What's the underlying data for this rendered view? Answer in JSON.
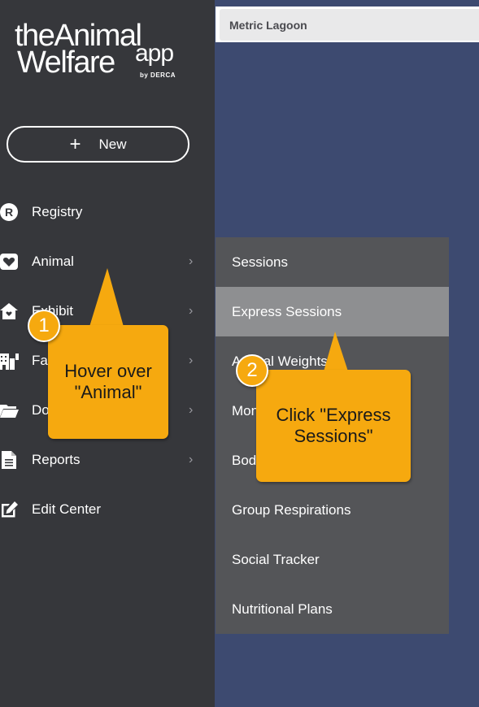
{
  "logo": {
    "line1": "theAnimal",
    "line2": "Welfare",
    "line3": "app",
    "byline": "by DERCA"
  },
  "new_button": {
    "label": "New"
  },
  "topbar": {
    "field_text": "Metric Lagoon"
  },
  "nav": [
    {
      "label": "Registry",
      "icon": "registry-r-icon",
      "chevron": false
    },
    {
      "label": "Animal",
      "icon": "heart-icon",
      "chevron": true
    },
    {
      "label": "Exhibit",
      "icon": "exhibit-home-icon",
      "chevron": true
    },
    {
      "label": "Facilities",
      "icon": "building-icon",
      "chevron": true
    },
    {
      "label": "Documents",
      "icon": "folder-icon",
      "chevron": true
    },
    {
      "label": "Reports",
      "icon": "report-document-icon",
      "chevron": true
    },
    {
      "label": "Edit Center",
      "icon": "edit-icon",
      "chevron": false
    }
  ],
  "submenu": [
    {
      "label": "Sessions",
      "active": false
    },
    {
      "label": "Express Sessions",
      "active": true
    },
    {
      "label": "Animal Weights",
      "active": false
    },
    {
      "label": "Monitoring",
      "active": false
    },
    {
      "label": "Body Condition",
      "active": false
    },
    {
      "label": "Group Respirations",
      "active": false
    },
    {
      "label": "Social Tracker",
      "active": false
    },
    {
      "label": "Nutritional Plans",
      "active": false
    }
  ],
  "callouts": [
    {
      "number": "1",
      "text": "Hover over \"Animal\""
    },
    {
      "number": "2",
      "text": "Click \"Express Sessions\""
    }
  ],
  "colors": {
    "sidebar": "#36373b",
    "submenu": "#545558",
    "submenu_active": "#8e8f91",
    "page_bg": "#3d4a70",
    "callout": "#f6a90f"
  }
}
